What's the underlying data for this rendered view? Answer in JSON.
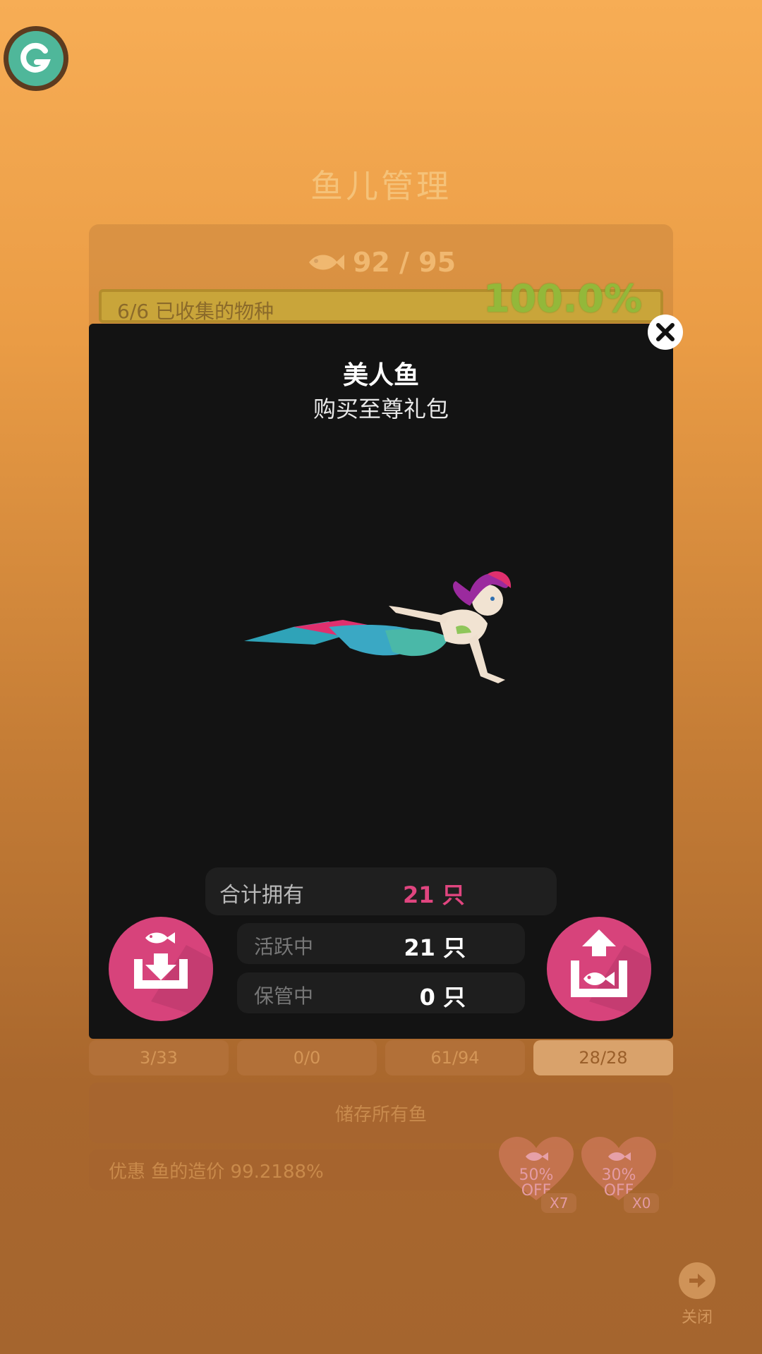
{
  "background": {
    "page_title": "鱼儿管理",
    "fish_count": "92 / 95",
    "collected_label": "6/6 已收集的物种",
    "collected_percent": "100.0%",
    "tabs": [
      "3/33",
      "0/0",
      "61/94",
      "28/28"
    ],
    "active_tab_index": 3,
    "store_all_label": "储存所有鱼",
    "discount_label": "优惠 鱼的造价 99.2188%",
    "coupons": [
      {
        "percent": "50%",
        "off": "OFF",
        "multiplier": "X7"
      },
      {
        "percent": "30%",
        "off": "OFF",
        "multiplier": "X0"
      }
    ],
    "close_label": "关闭"
  },
  "modal": {
    "title": "美人鱼",
    "subtitle": "购买至尊礼包",
    "total_label": "合计拥有",
    "total_value": "21 只",
    "active_label": "活跃中",
    "active_value": "21 只",
    "stored_label": "保管中",
    "stored_value": "0 只"
  },
  "icons": {
    "app_logo": "g-logo-icon",
    "close": "close-icon",
    "store_fish": "store-fish-icon",
    "release_fish": "release-fish-icon",
    "fish": "fish-icon",
    "arrow_right": "arrow-right-icon"
  },
  "colors": {
    "accent_pink": "#d7437b",
    "total_value_pink": "#e0457f",
    "logo_green": "#4fb79a"
  }
}
